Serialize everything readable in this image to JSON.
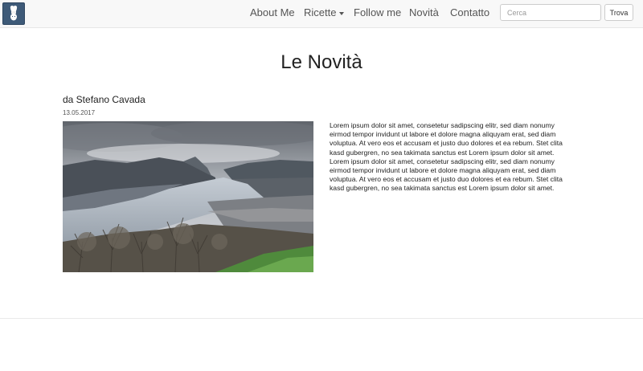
{
  "nav": {
    "items": [
      {
        "label": "About Me"
      },
      {
        "label": "Ricette"
      },
      {
        "label": "Follow me"
      },
      {
        "label": "Novità"
      },
      {
        "label": "Contatto"
      }
    ],
    "search": {
      "placeholder": "Cerca",
      "button_label": "Trova"
    }
  },
  "page": {
    "title": "Le Novità"
  },
  "post": {
    "author": "da Stefano Cavada",
    "date": "13.05.2017",
    "image": {
      "icon": "lake-mountain-photo"
    },
    "text": "Lorem ipsum dolor sit amet, consetetur sadipscing elitr, sed diam nonumy eirmod tempor invidunt ut labore et dolore magna aliquyam erat, sed diam voluptua. At vero eos et accusam et justo duo dolores et ea rebum. Stet clita kasd gubergren, no sea takimata sanctus est Lorem ipsum dolor sit amet. Lorem ipsum dolor sit amet, consetetur sadipscing elitr, sed diam nonumy eirmod tempor invidunt ut labore et dolore magna aliquyam erat, sed diam voluptua. At vero eos et accusam et justo duo dolores et ea rebum. Stet clita kasd gubergren, no sea takimata sanctus est Lorem ipsum dolor sit amet."
  },
  "colors": {
    "navbar_bg": "#f8f8f8",
    "logo_bg": "#3e5a78",
    "text": "#222222"
  }
}
